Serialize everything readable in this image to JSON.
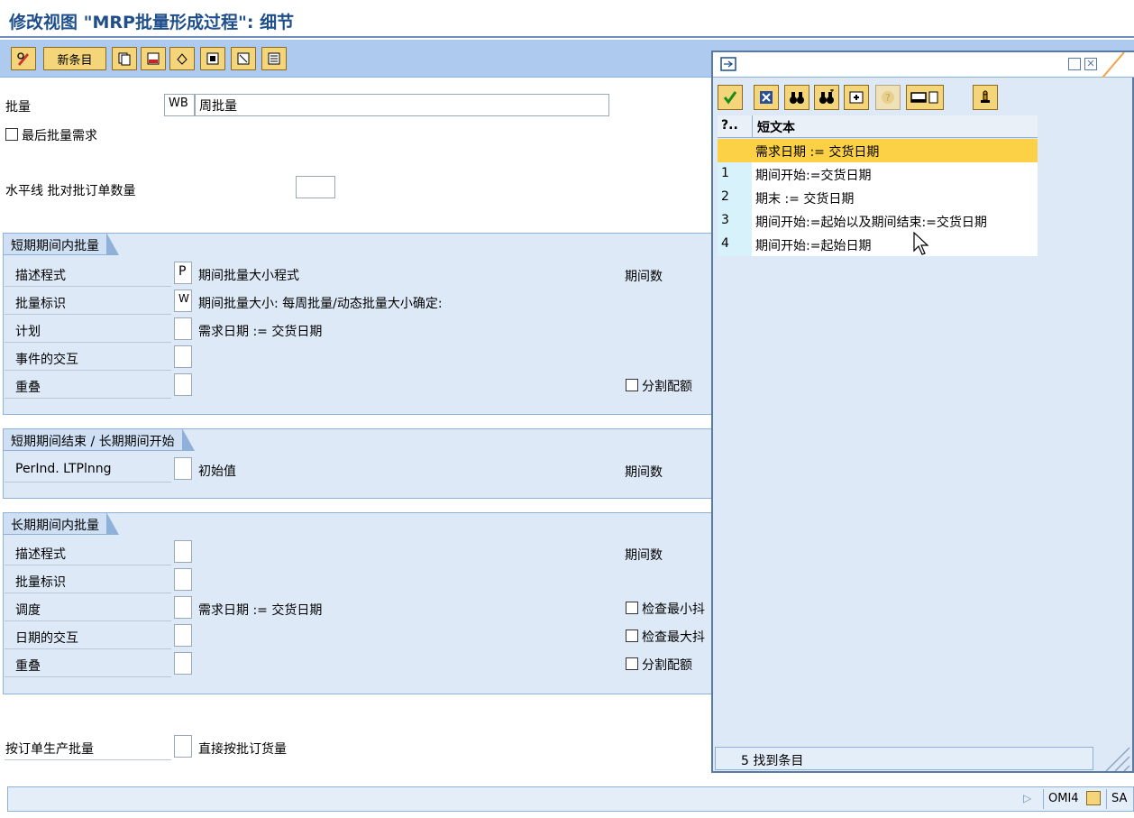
{
  "window": {
    "title": "修改视图 \"MRP批量形成过程\": 细节"
  },
  "toolbar": {
    "new_entries_label": "新条目"
  },
  "header_fields": {
    "lot_size_label": "批量",
    "lot_size_code": "WB",
    "lot_size_text": "周批量",
    "last_lot_req_label": "最后批量需求",
    "horizon_label": "水平线 批对批订单数量"
  },
  "short_term": {
    "group_title": "短期期间内批量",
    "rows": [
      {
        "label": "描述程式",
        "code": "P",
        "text": "期间批量大小程式"
      },
      {
        "label": "批量标识",
        "code": "W",
        "text": "期间批量大小: 每周批量/动态批量大小确定:"
      },
      {
        "label": "计划",
        "code": "",
        "text": "需求日期 := 交货日期"
      },
      {
        "label": "事件的交互",
        "code": "",
        "text": ""
      },
      {
        "label": "重叠",
        "code": "",
        "text": ""
      }
    ],
    "periods_label": "期间数",
    "split_quota_label": "分割配额"
  },
  "transition": {
    "group_title": "短期期间结束 / 长期期间开始",
    "row_label": "PerInd. LTPlnng",
    "row_text": "初始值",
    "periods_label": "期间数"
  },
  "long_term": {
    "group_title": "长期期间内批量",
    "rows": [
      {
        "label": "描述程式",
        "text": ""
      },
      {
        "label": "批量标识",
        "text": ""
      },
      {
        "label": "调度",
        "text": "需求日期 := 交货日期"
      },
      {
        "label": "日期的交互",
        "text": ""
      },
      {
        "label": "重叠",
        "text": ""
      }
    ],
    "periods_label": "期间数",
    "check_min_label": "检查最小抖",
    "check_max_label": "检查最大抖",
    "split_quota_label": "分割配额"
  },
  "footer_fields": {
    "order_lot_label": "按订单生产批量",
    "order_lot_text": "直接按批订货量"
  },
  "statusbar": {
    "transaction": "OMI4",
    "system": "SA"
  },
  "popup": {
    "grid_headers": {
      "idx": "?..",
      "text": "短文本"
    },
    "rows": [
      {
        "idx": "",
        "text": "需求日期 := 交货日期"
      },
      {
        "idx": "1",
        "text": "期间开始:=交货日期"
      },
      {
        "idx": "2",
        "text": "期末 := 交货日期"
      },
      {
        "idx": "3",
        "text": "期间开始:=起始以及期间结束:=交货日期"
      },
      {
        "idx": "4",
        "text": "期间开始:=起始日期"
      }
    ],
    "status_text": "5 找到条目"
  },
  "colors": {
    "title_blue": "#1f4f8a",
    "toolbar_blue": "#aecbef",
    "group_bg": "#dde9f7",
    "button_gold": "#f4d57a",
    "selected_row": "#fcd146"
  }
}
